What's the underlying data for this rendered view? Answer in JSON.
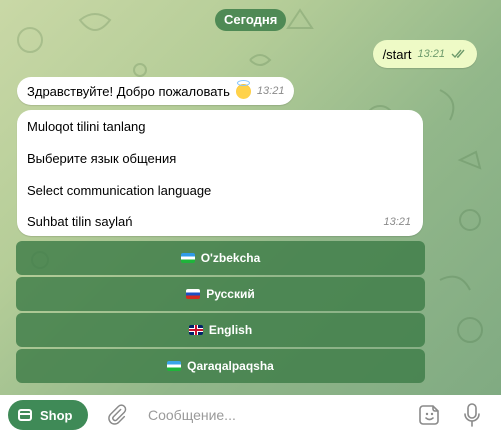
{
  "chat": {
    "date_chip": "Сегодня",
    "outgoing": {
      "text": "/start",
      "time": "13:21",
      "status": "read"
    },
    "welcome": {
      "text": "Здравствуйте! Добро пожаловать",
      "emoji": "smiling-face-with-halo",
      "time": "13:21"
    },
    "language_prompt": {
      "lines": [
        "Muloqot tilini tanlang",
        "Выберите язык общения",
        "Select communication language",
        "Suhbat tilin saylań"
      ],
      "time": "13:21"
    }
  },
  "keyboard": [
    {
      "label": "O'zbekcha",
      "flag": "uz-flag"
    },
    {
      "label": "Русский",
      "flag": "ru-flag"
    },
    {
      "label": "English",
      "flag": "gb-flag"
    },
    {
      "label": "Qaraqalpaqsha",
      "flag": "uz-flag"
    }
  ],
  "composer": {
    "shop_label": "Shop",
    "placeholder": "Сообщение...",
    "icons": [
      "shop-icon",
      "paperclip-icon",
      "sticker-icon",
      "microphone-icon"
    ]
  },
  "colors": {
    "outgoing_bubble": "#eefac6",
    "date_chip": "#4f8a55",
    "keyboard_button": "#3e7d48",
    "shop_button": "#3f8a57"
  }
}
